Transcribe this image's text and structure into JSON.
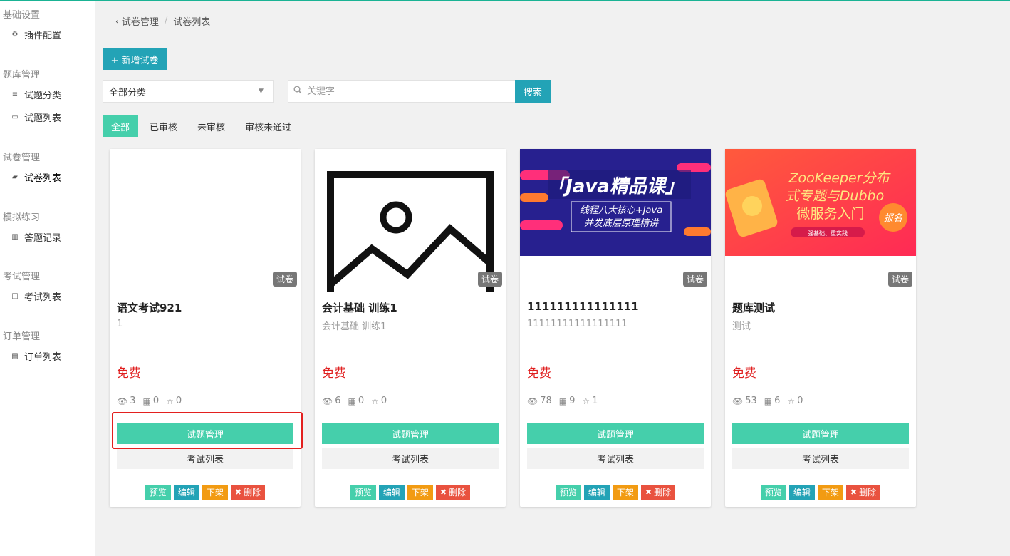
{
  "sidebar": {
    "groups": [
      {
        "title": "基础设置",
        "items": [
          {
            "label": "插件配置",
            "icon": "gears-icon"
          }
        ]
      },
      {
        "title": "题库管理",
        "items": [
          {
            "label": "试题分类",
            "icon": "list-icon"
          },
          {
            "label": "试题列表",
            "icon": "calendar-icon"
          }
        ]
      },
      {
        "title": "试卷管理",
        "items": [
          {
            "label": "试卷列表",
            "icon": "folder-open-icon"
          }
        ]
      },
      {
        "title": "模拟练习",
        "items": [
          {
            "label": "答题记录",
            "icon": "bar-chart-icon"
          }
        ]
      },
      {
        "title": "考试管理",
        "items": [
          {
            "label": "考试列表",
            "icon": "square-icon"
          }
        ]
      },
      {
        "title": "订单管理",
        "items": [
          {
            "label": "订单列表",
            "icon": "card-icon"
          }
        ]
      }
    ]
  },
  "breadcrumb": {
    "parent": "试卷管理",
    "current": "试卷列表"
  },
  "toolbar": {
    "add_label": "+ 新增试卷"
  },
  "filter": {
    "category_selected": "全部分类",
    "search_placeholder": "关键字",
    "search_label": "搜索"
  },
  "tabs": [
    "全部",
    "已审核",
    "未审核",
    "审核未通过"
  ],
  "cards": [
    {
      "badge": "试卷",
      "title": "语文考试921",
      "subtitle": "1",
      "price": "免费",
      "views": "3",
      "buys": "0",
      "stars": "0",
      "thumb": "blank"
    },
    {
      "badge": "试卷",
      "title": "会计基础 训练1",
      "subtitle": "会计基础 训练1",
      "price": "免费",
      "views": "6",
      "buys": "0",
      "stars": "0",
      "thumb": "placeholder-image"
    },
    {
      "badge": "试卷",
      "title": "111111111111111",
      "subtitle": "11111111111111111",
      "price": "免费",
      "views": "78",
      "buys": "9",
      "stars": "1",
      "thumb": "java-banner",
      "banner": {
        "line1": "「Java精品课」",
        "line2": "线程八大核心+Java",
        "line3": "并发底层原理精讲"
      }
    },
    {
      "badge": "试卷",
      "title": "题库测试",
      "subtitle": "测试",
      "price": "免费",
      "views": "53",
      "buys": "6",
      "stars": "0",
      "thumb": "zk-banner",
      "banner": {
        "line1": "ZooKeeper分布",
        "line2": "式专题与Dubbo",
        "line3": "微服务入门",
        "tag": "报名",
        "note": "强基础、重实践"
      }
    }
  ],
  "card_buttons": {
    "questions": "试题管理",
    "exams": "考试列表"
  },
  "card_actions": {
    "preview": "预览",
    "edit": "编辑",
    "offline": "下架",
    "delete": "删除"
  },
  "colors": {
    "accent": "#45cfab",
    "teal": "#23a3b6",
    "orange": "#f29b12",
    "red": "#e9523f",
    "price": "#e02020",
    "highlight": "#e3201f"
  }
}
